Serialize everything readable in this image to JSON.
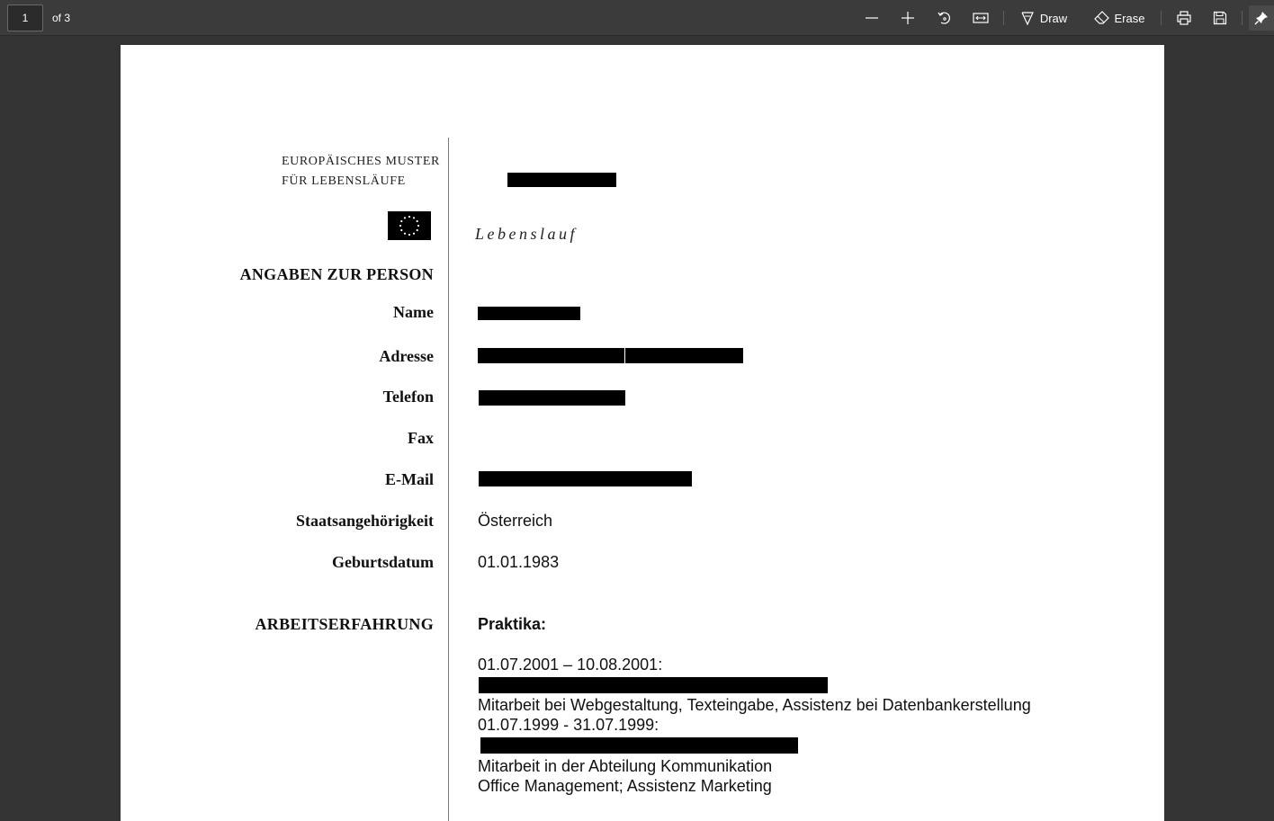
{
  "toolbar": {
    "page_number": "1",
    "page_total": "of 3",
    "draw_label": "Draw",
    "erase_label": "Erase"
  },
  "document": {
    "europass_line1": "EUROPÄISCHES MUSTER",
    "europass_line2": "FÜR LEBENSLÄUFE",
    "subtitle": "Lebenslauf",
    "personal_heading": "ANGABEN ZUR PERSON",
    "fields": {
      "name_label": "Name",
      "address_label": "Adresse",
      "phone_label": "Telefon",
      "fax_label": "Fax",
      "email_label": "E-Mail",
      "nationality_label": "Staatsangehörigkeit",
      "nationality_value": "Österreich",
      "birthdate_label": "Geburtsdatum",
      "birthdate_value": "01.01.1983"
    },
    "experience": {
      "heading": "ARBEITSERFAHRUNG",
      "subheading": "Praktika:",
      "entry1_dates": "01.07.2001 – 10.08.2001:",
      "entry1_desc": "Mitarbeit bei Webgestaltung, Texteingabe, Assistenz bei Datenbankerstellung",
      "entry2_dates": "01.07.1999 - 31.07.1999:",
      "entry2_desc1": "Mitarbeit in der Abteilung Kommunikation",
      "entry2_desc2": "Office Management; Assistenz Marketing"
    }
  }
}
